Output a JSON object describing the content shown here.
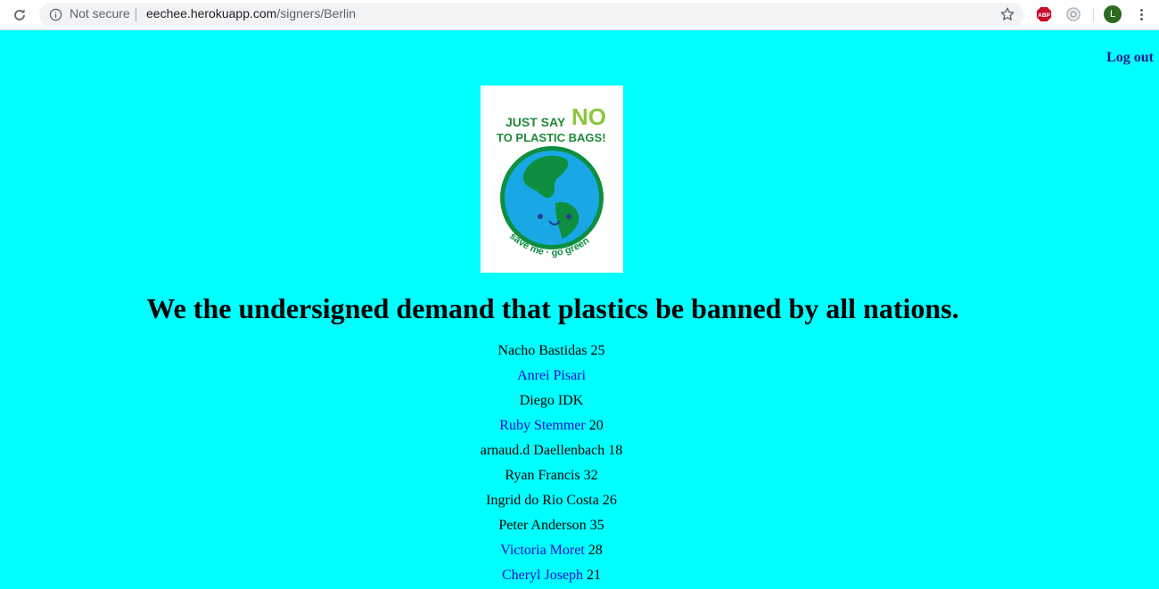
{
  "browser": {
    "security_label": "Not secure",
    "url_host": "eechee.herokuapp.com",
    "url_path": "/signers/Berlin",
    "profile_initial": "L",
    "abp_label": "ABP"
  },
  "header": {
    "logout_label": "Log out"
  },
  "poster": {
    "line1_a": "JUST SAY",
    "line1_b": "NO",
    "line2": "TO PLASTIC BAGS!",
    "tagline": "save me · go green"
  },
  "headline": "We the undersigned demand that plastics be banned by all nations.",
  "signers": [
    {
      "name": "Nacho Bastidas",
      "age": "25",
      "linked": false
    },
    {
      "name": "Anrei Pisari",
      "age": "",
      "linked": true
    },
    {
      "name": "Diego IDK",
      "age": "",
      "linked": false
    },
    {
      "name": "Ruby Stemmer",
      "age": "20",
      "linked": true
    },
    {
      "name": "arnaud.d Daellenbach",
      "age": "18",
      "linked": false
    },
    {
      "name": "Ryan Francis",
      "age": "32",
      "linked": false
    },
    {
      "name": "Ingrid do Rio Costa",
      "age": "26",
      "linked": false
    },
    {
      "name": "Peter Anderson",
      "age": "35",
      "linked": false
    },
    {
      "name": "Victoria Moret",
      "age": "28",
      "linked": true
    },
    {
      "name": "Cheryl Joseph",
      "age": "21",
      "linked": true
    }
  ]
}
